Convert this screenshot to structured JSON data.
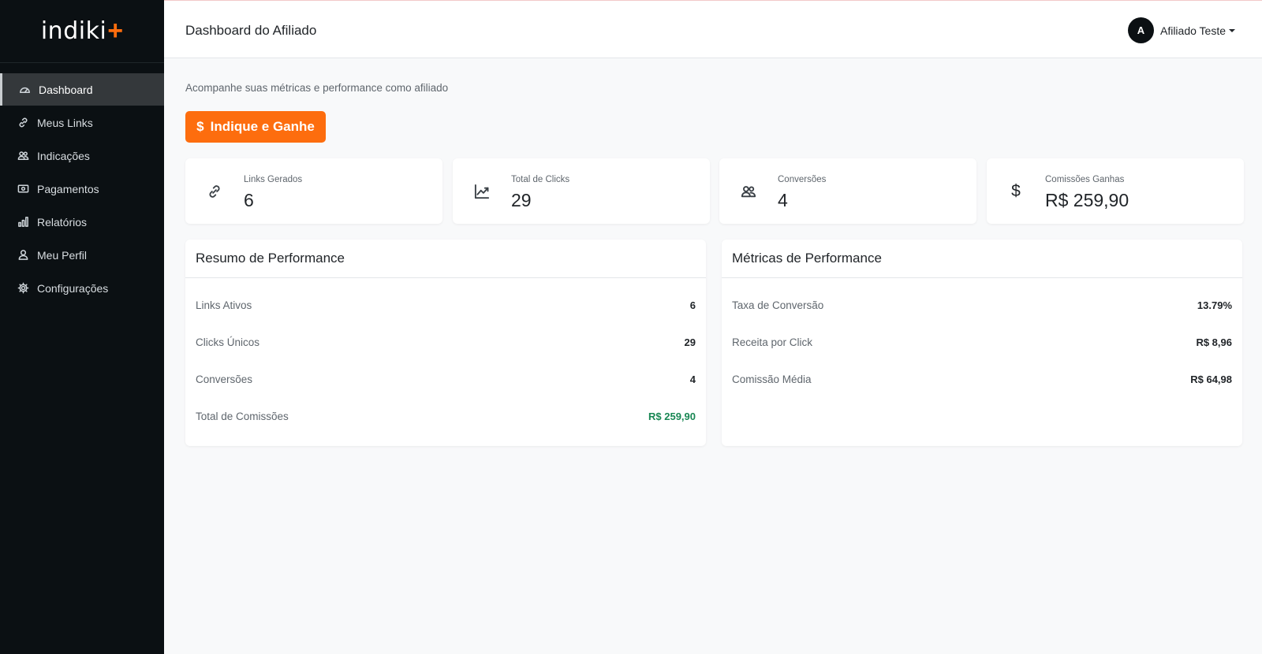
{
  "brand": {
    "name": "indiki",
    "accent": "+"
  },
  "sidebar": {
    "items": [
      {
        "label": "Dashboard",
        "icon": "gauge-icon",
        "active": true
      },
      {
        "label": "Meus Links",
        "icon": "link-icon"
      },
      {
        "label": "Indicações",
        "icon": "people-icon"
      },
      {
        "label": "Pagamentos",
        "icon": "cash-icon"
      },
      {
        "label": "Relatórios",
        "icon": "bar-chart-icon"
      },
      {
        "label": "Meu Perfil",
        "icon": "person-icon"
      },
      {
        "label": "Configurações",
        "icon": "gear-icon"
      }
    ]
  },
  "header": {
    "title": "Dashboard do Afiliado",
    "user": {
      "initial": "A",
      "name": "Afiliado Teste"
    }
  },
  "main": {
    "subtitle": "Acompanhe suas métricas e performance como afiliado",
    "cta": {
      "icon": "$",
      "label": "Indique e Ganhe"
    },
    "stats": [
      {
        "label": "Links Gerados",
        "value": "6",
        "icon": "link-icon"
      },
      {
        "label": "Total de Clicks",
        "value": "29",
        "icon": "trend-chart-icon"
      },
      {
        "label": "Conversões",
        "value": "4",
        "icon": "people-icon"
      },
      {
        "label": "Comissões Ganhas",
        "value": "R$ 259,90",
        "icon": "dollar-icon",
        "symbol": "$"
      }
    ],
    "summary": {
      "title": "Resumo de Performance",
      "rows": [
        {
          "label": "Links Ativos",
          "value": "6"
        },
        {
          "label": "Clicks Únicos",
          "value": "29"
        },
        {
          "label": "Conversões",
          "value": "4"
        },
        {
          "label": "Total de Comissões",
          "value": "R$ 259,90"
        }
      ]
    },
    "metrics": {
      "title": "Métricas de Performance",
      "rows": [
        {
          "label": "Taxa de Conversão",
          "value": "13.79%"
        },
        {
          "label": "Receita por Click",
          "value": "R$ 8,96"
        },
        {
          "label": "Comissão Média",
          "value": "R$ 64,98"
        }
      ]
    }
  },
  "colors": {
    "sidebar_bg": "#0b1013",
    "accent_orange": "#fd6d0e",
    "success_green": "#198754",
    "page_bg": "#f8f9fa"
  }
}
